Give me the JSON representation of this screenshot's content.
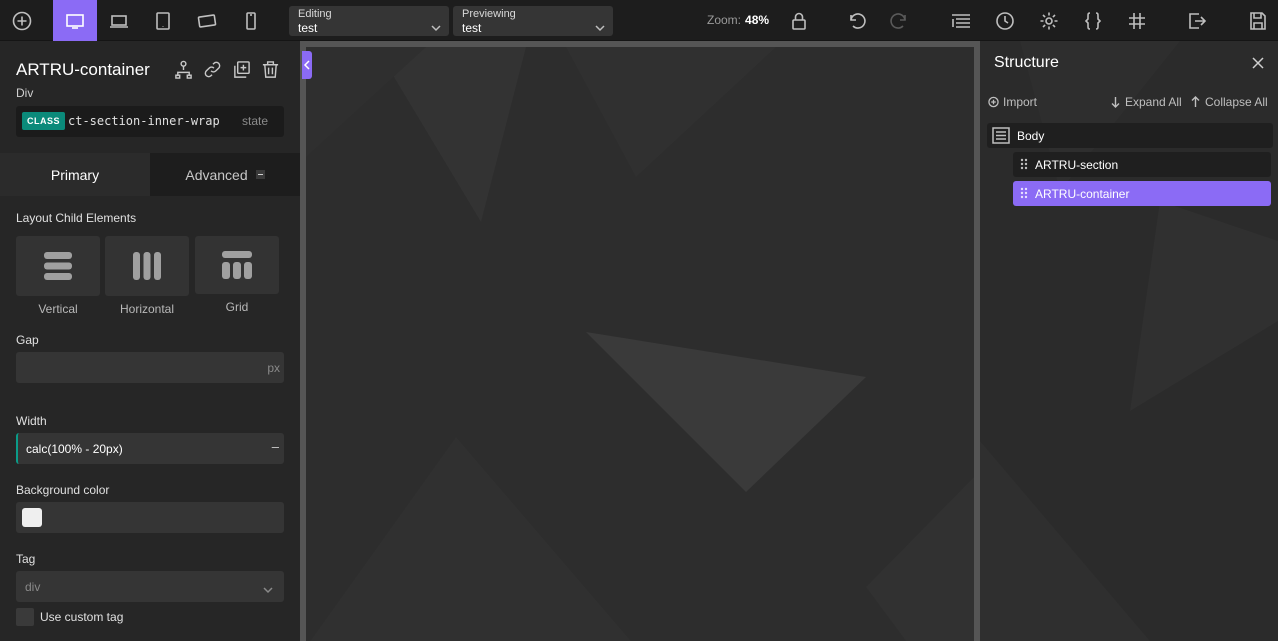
{
  "toolbar": {
    "icons": [
      "add-icon",
      "desktop-icon",
      "laptop-icon",
      "tablet-icon",
      "tablet-landscape-icon",
      "phone-icon",
      "lock-icon",
      "undo-icon",
      "redo-icon",
      "menu-list-icon",
      "history-icon",
      "settings-icon",
      "code-braces-icon",
      "grid-icon",
      "exit-icon",
      "save-icon"
    ],
    "editing_label": "Editing",
    "editing_value": "test",
    "previewing_label": "Previewing",
    "previewing_value": "test",
    "zoom_label": "Zoom:",
    "zoom_value": "48%"
  },
  "left_panel": {
    "element_title": "ARTRU-container",
    "element_type": "Div",
    "class_badge": "CLASS",
    "class_name": "ct-section-inner-wrap",
    "state_label": "state",
    "tabs": {
      "primary": "Primary",
      "advanced": "Advanced"
    },
    "layout_label": "Layout Child Elements",
    "layout_options": [
      "Vertical",
      "Horizontal",
      "Grid"
    ],
    "gap_label": "Gap",
    "gap_unit": "px",
    "width_label": "Width",
    "width_value": "calc(100% - 20px)",
    "width_unit": "–",
    "bg_color_label": "Background color",
    "bg_color_value": "#efefef",
    "tag_label": "Tag",
    "tag_value": "div",
    "custom_tag_label": "Use custom tag"
  },
  "structure": {
    "title": "Structure",
    "import_label": "Import",
    "expand_label": "Expand All",
    "collapse_label": "Collapse All",
    "tree": [
      {
        "label": "Body",
        "level": 0,
        "selected": false
      },
      {
        "label": "ARTRU-section",
        "level": 1,
        "selected": false
      },
      {
        "label": "ARTRU-container",
        "level": 1,
        "selected": true
      }
    ]
  },
  "colors": {
    "accent": "#8b6bf5",
    "class_badge": "#0b8a7a"
  }
}
